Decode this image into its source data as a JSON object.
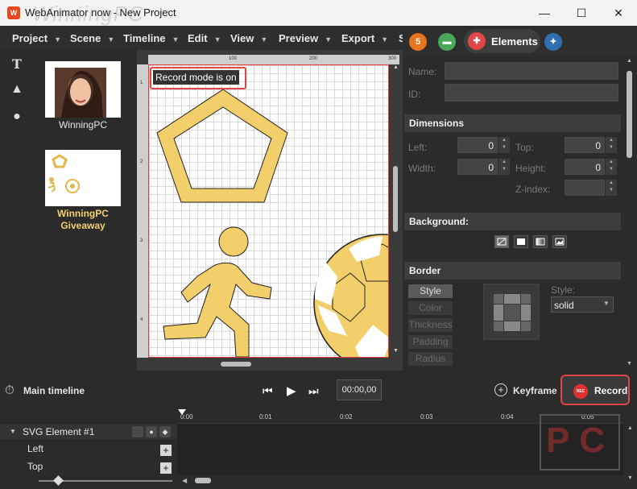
{
  "window": {
    "title": "WebAnimator now - New Project",
    "watermark": "WinningPC",
    "app_icon": "W",
    "minimize_icon": "—",
    "maximize_icon": "☐",
    "close_icon": "✕"
  },
  "menu": {
    "items": [
      "Project",
      "Scene",
      "Timeline",
      "Edit",
      "View",
      "Preview",
      "Export",
      "S"
    ],
    "arrow": "▼"
  },
  "tabs": {
    "html5_icon": "5",
    "scenes_icon": "▬",
    "elements_label": "Elements",
    "elements_icon": "✚",
    "effects_icon": "✦"
  },
  "tools": {
    "text_icon": "T",
    "image_icon": "▲",
    "shape_icon": "●"
  },
  "scenes": [
    {
      "label": "WinningPC"
    },
    {
      "label": "WinningPC Giveaway"
    }
  ],
  "canvas": {
    "ruler_top": [
      "100",
      "200",
      "300"
    ],
    "ruler_left": [
      "1",
      "2",
      "3",
      "4"
    ],
    "record_badge": "Record mode is on"
  },
  "properties": {
    "name_label": "Name:",
    "name_value": "",
    "id_label": "ID:",
    "id_value": "",
    "dimensions_title": "Dimensions",
    "left_label": "Left:",
    "left_value": "0",
    "top_label": "Top:",
    "top_value": "0",
    "width_label": "Width:",
    "width_value": "0",
    "height_label": "Height:",
    "height_value": "0",
    "zindex_label": "Z-index:",
    "zindex_value": "",
    "background_title": "Background:",
    "border_title": "Border",
    "border_tabs": [
      "Style",
      "Color",
      "Thickness",
      "Padding",
      "Radius"
    ],
    "style_label": "Style:",
    "style_value": "solid"
  },
  "timeline": {
    "title": "Main timeline",
    "time": "00:00,00",
    "keyframe_label": "Keyframe",
    "record_label": "Record",
    "rec_icon_text": "REC",
    "ticks": [
      "0:00",
      "0:01",
      "0:02",
      "0:03",
      "0:04",
      "0:05"
    ],
    "element_label": "SVG Element #1",
    "props": [
      "Left",
      "Top"
    ],
    "add_icon": "+",
    "logo_text": "PC"
  },
  "colors": {
    "accent_red": "#e04646",
    "shape_fill": "#f2cf6b",
    "panel_bg": "#2b2b2b"
  }
}
